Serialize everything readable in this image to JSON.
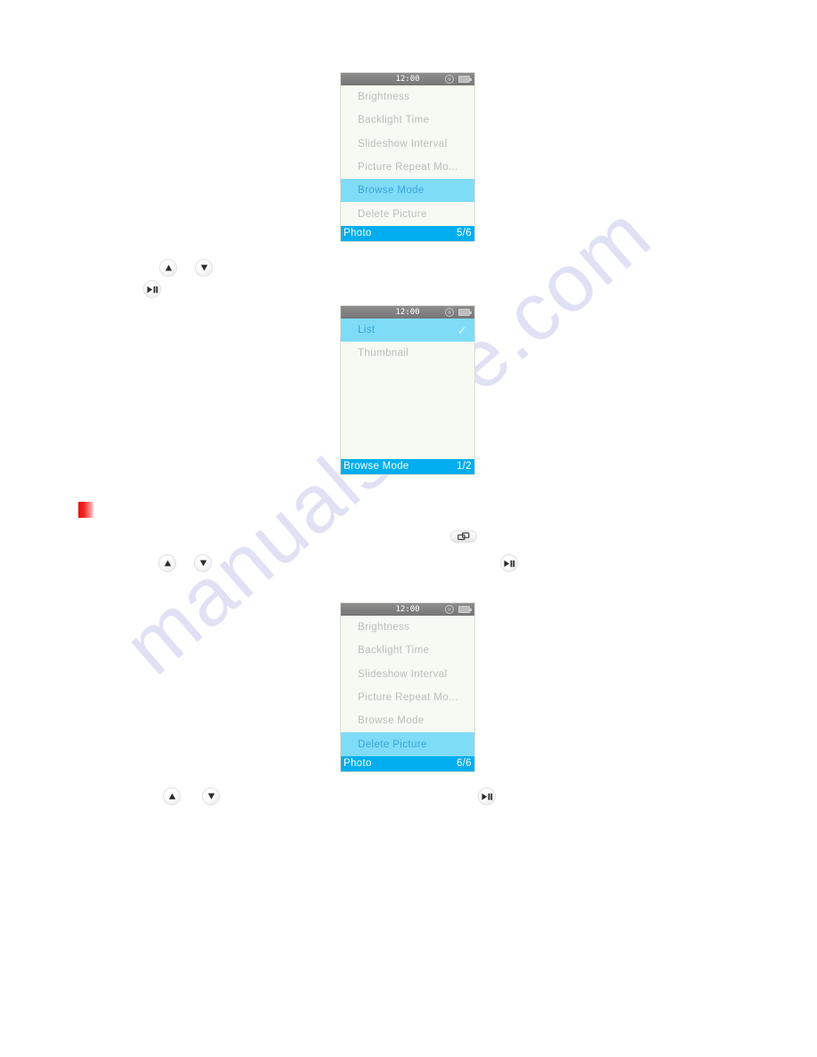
{
  "page": {
    "watermark_text": "manualshive.com",
    "background_color": "#ffffff"
  },
  "colors": {
    "titlebar": "#808080",
    "screen_bg": "#f6faf2",
    "highlight": "#7fdcf7",
    "highlight_text": "#3aa3d6",
    "footer": "#00aeef",
    "dim_text": "#b9bdb9",
    "marker_red": "#ee1111"
  },
  "screens": [
    {
      "name": "photo-settings-browse-mode",
      "clock": "12:00",
      "status_icons": [
        "sound-icon",
        "battery-icon"
      ],
      "rows": [
        {
          "label": "Brightness",
          "selected": false,
          "checked": false
        },
        {
          "label": "Backlight Time",
          "selected": false,
          "checked": false
        },
        {
          "label": "Slideshow Interval",
          "selected": false,
          "checked": false
        },
        {
          "label": "Picture Repeat Mo...",
          "selected": false,
          "checked": false
        },
        {
          "label": "Browse Mode",
          "selected": true,
          "checked": false
        },
        {
          "label": "Delete Picture",
          "selected": false,
          "checked": false
        }
      ],
      "footer_title": "Photo",
      "footer_count": "5/6"
    },
    {
      "name": "browse-mode-options",
      "clock": "12:00",
      "status_icons": [
        "sound-icon",
        "battery-icon"
      ],
      "rows": [
        {
          "label": "List",
          "selected": true,
          "checked": true
        },
        {
          "label": "Thumbnail",
          "selected": false,
          "checked": false
        }
      ],
      "footer_title": "Browse Mode",
      "footer_count": "1/2"
    },
    {
      "name": "photo-settings-delete-picture",
      "clock": "12:00",
      "status_icons": [
        "sound-icon",
        "battery-icon"
      ],
      "rows": [
        {
          "label": "Brightness",
          "selected": false,
          "checked": false
        },
        {
          "label": "Backlight Time",
          "selected": false,
          "checked": false
        },
        {
          "label": "Slideshow Interval",
          "selected": false,
          "checked": false
        },
        {
          "label": "Picture Repeat Mo...",
          "selected": false,
          "checked": false
        },
        {
          "label": "Browse Mode",
          "selected": false,
          "checked": false
        },
        {
          "label": "Delete Picture",
          "selected": true,
          "checked": false
        }
      ],
      "footer_title": "Photo",
      "footer_count": "6/6"
    }
  ],
  "buttons": [
    {
      "name": "up-button-1",
      "icon": "up-arrow-icon"
    },
    {
      "name": "down-button-1",
      "icon": "down-arrow-icon"
    },
    {
      "name": "play-pause-button-1",
      "icon": "play-pause-icon"
    },
    {
      "name": "up-button-2",
      "icon": "up-arrow-icon"
    },
    {
      "name": "down-button-2",
      "icon": "down-arrow-icon"
    },
    {
      "name": "menu-button",
      "icon": "window-switch-icon"
    },
    {
      "name": "play-pause-button-2",
      "icon": "play-pause-icon"
    },
    {
      "name": "up-button-3",
      "icon": "up-arrow-icon"
    },
    {
      "name": "down-button-3",
      "icon": "down-arrow-icon"
    },
    {
      "name": "play-pause-button-3",
      "icon": "play-pause-icon"
    }
  ],
  "marker": {
    "name": "red-square-marker",
    "color": "#ee1111"
  }
}
